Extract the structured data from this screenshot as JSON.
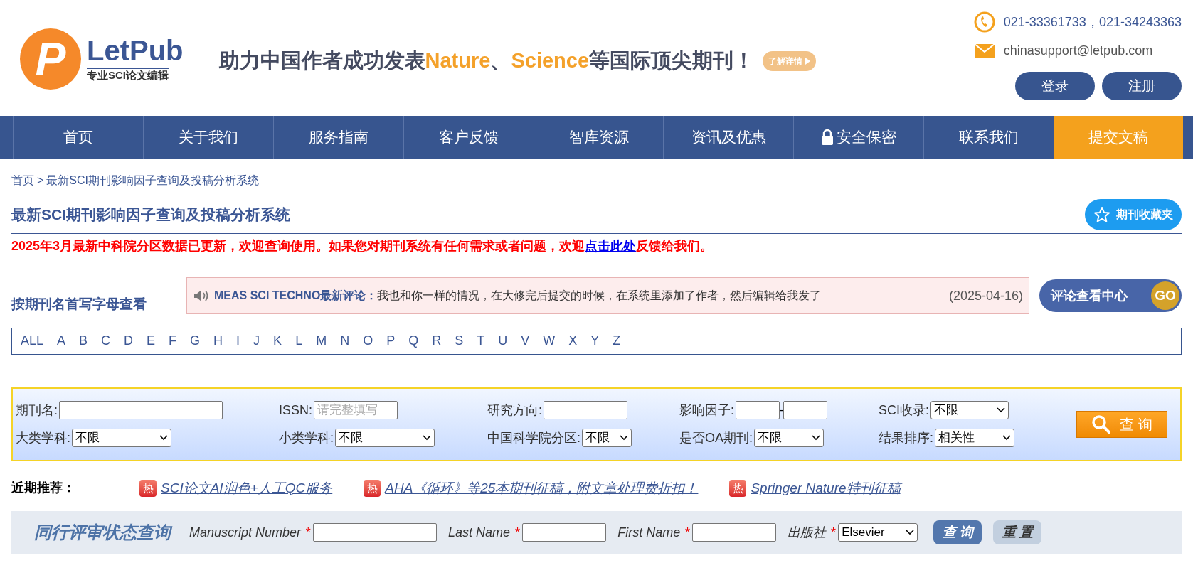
{
  "header": {
    "logo": {
      "letter": "P",
      "name": "LetPub",
      "tagline": "专业SCI论文编辑"
    },
    "slogan": [
      {
        "text": "助力中国作者成功发表",
        "highlight": false
      },
      {
        "text": "Nature",
        "highlight": true
      },
      {
        "text": "、",
        "highlight": false
      },
      {
        "text": "Science",
        "highlight": true
      },
      {
        "text": "等国际顶尖期刊！",
        "highlight": false
      }
    ],
    "details_button": "了解详情",
    "phone": "021-33361733，021-34243363",
    "email": "chinasupport@letpub.com",
    "buttons": [
      "登录",
      "注册"
    ]
  },
  "nav": [
    {
      "label": "首页",
      "kind": "plain"
    },
    {
      "label": "关于我们",
      "kind": "plain"
    },
    {
      "label": "服务指南",
      "kind": "plain"
    },
    {
      "label": "客户反馈",
      "kind": "plain"
    },
    {
      "label": "智库资源",
      "kind": "plain"
    },
    {
      "label": "资讯及优惠",
      "kind": "plain"
    },
    {
      "label": "安全保密",
      "kind": "lock"
    },
    {
      "label": "联系我们",
      "kind": "plain"
    },
    {
      "label": "提交文稿",
      "kind": "cta"
    }
  ],
  "breadcrumb": {
    "items": [
      "首页",
      "最新SCI期刊影响因子查询及投稿分析系统"
    ],
    "separator": ">"
  },
  "title": "最新SCI期刊影响因子查询及投稿分析系统",
  "favorites_button": "期刊收藏夹",
  "notice": {
    "before": "2025年3月最新中科院分区数据已更新，欢迎查询使用。如果您对期刊系统有任何需求或者问题，欢迎",
    "link": "点击此处",
    "after": "反馈给我们。"
  },
  "letter_browse": "按期刊名首写字母查看",
  "comment": {
    "journal": "MEAS SCI TECHNO最新评论：",
    "text": "我也和你一样的情况，在大修完后提交的时候，在系统里添加了作者，然后编辑给我发了",
    "date": "(2025-04-16)"
  },
  "comment_center_button": {
    "label": "评论查看中心",
    "go": "GO"
  },
  "alphabet": [
    "ALL",
    "A",
    "B",
    "C",
    "D",
    "E",
    "F",
    "G",
    "H",
    "I",
    "J",
    "K",
    "L",
    "M",
    "N",
    "O",
    "P",
    "Q",
    "R",
    "S",
    "T",
    "U",
    "V",
    "W",
    "X",
    "Y",
    "Z"
  ],
  "search_form": {
    "fields": [
      {
        "label": "期刊名:",
        "kind": "text"
      },
      {
        "label": "ISSN:",
        "kind": "text",
        "placeholder": "请完整填写"
      },
      {
        "label": "研究方向:",
        "kind": "text"
      },
      {
        "label": "影响因子:",
        "kind": "range",
        "separator": "-"
      },
      {
        "label": "SCI收录:",
        "kind": "select",
        "value": "不限"
      },
      {
        "label": "大类学科:",
        "kind": "select",
        "value": "不限"
      },
      {
        "label": "小类学科:",
        "kind": "select",
        "value": "不限"
      },
      {
        "label": "中国科学院分区:",
        "kind": "select",
        "value": "不限"
      },
      {
        "label": "是否OA期刊:",
        "kind": "select",
        "value": "不限"
      },
      {
        "label": "结果排序:",
        "kind": "select",
        "value": "相关性"
      }
    ],
    "button": "查 询"
  },
  "recommend": {
    "label": "近期推荐：",
    "items": [
      {
        "badge": "热",
        "text": "SCI论文AI润色+人工QC服务"
      },
      {
        "badge": "热",
        "text": "AHA《循环》等25本期刊征稿，附文章处理费折扣！"
      },
      {
        "badge": "热",
        "text": "Springer Nature特刊征稿"
      }
    ]
  },
  "peer_review": {
    "title": "同行评审状态查询",
    "fields": [
      {
        "label": "Manuscript Number",
        "mark": "*",
        "kind": "text"
      },
      {
        "label": "Last Name",
        "mark": "*",
        "kind": "text"
      },
      {
        "label": "First Name",
        "mark": "*",
        "kind": "text"
      },
      {
        "label": "出版社",
        "mark": "*",
        "kind": "select",
        "value": "Elsevier"
      }
    ],
    "buttons": [
      {
        "label": "查 询",
        "kind": "primary"
      },
      {
        "label": "重 置",
        "kind": "secondary"
      }
    ]
  }
}
